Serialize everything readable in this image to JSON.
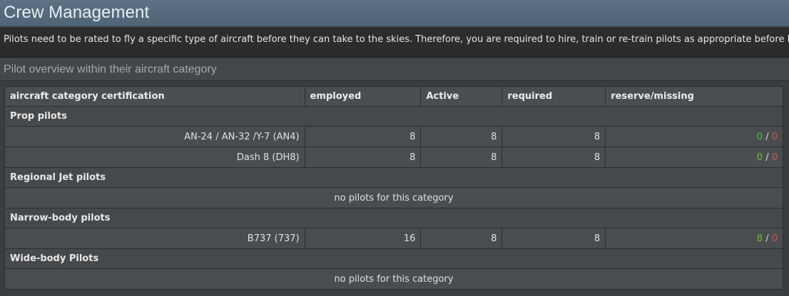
{
  "header": {
    "title": "Crew Management"
  },
  "intro": {
    "text": "Pilots need to be rated to fly a specific type of aircraft before they can take to the skies. Therefore, you are required to hire, train or re-train pilots as appropriate before letting them l"
  },
  "section": {
    "title": "Pilot overview within their aircraft category"
  },
  "table": {
    "columns": [
      "aircraft category certification",
      "employed",
      "Active",
      "required",
      "reserve/missing"
    ],
    "categories": [
      {
        "name": "Prop pilots",
        "rows": [
          {
            "aircraft": "AN-24 / AN-32 /Y-7 (AN4)",
            "employed": "8",
            "active": "8",
            "required": "8",
            "reserve": "0",
            "missing": "0"
          },
          {
            "aircraft": "Dash 8 (DH8)",
            "employed": "8",
            "active": "8",
            "required": "8",
            "reserve": "0",
            "missing": "0"
          }
        ]
      },
      {
        "name": "Regional Jet pilots",
        "empty_text": "no pilots for this category"
      },
      {
        "name": "Narrow-body pilots",
        "rows": [
          {
            "aircraft": "B737 (737)",
            "employed": "16",
            "active": "8",
            "required": "8",
            "reserve": "8",
            "missing": "0"
          }
        ]
      },
      {
        "name": "Wide-body Pilots",
        "empty_text": "no pilots for this category"
      }
    ],
    "separator": "/"
  },
  "colors": {
    "title_bar": "#55697c",
    "reserve": "#5fbf3c",
    "missing": "#d9534f"
  }
}
